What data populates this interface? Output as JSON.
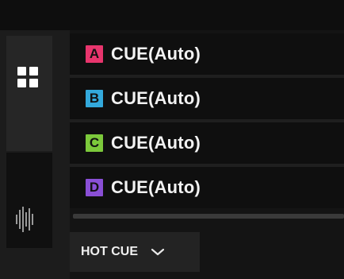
{
  "cues": [
    {
      "letter": "A",
      "label": "CUE(Auto)",
      "color": "#e8356d"
    },
    {
      "letter": "B",
      "label": "CUE(Auto)",
      "color": "#33a9dc"
    },
    {
      "letter": "C",
      "label": "CUE(Auto)",
      "color": "#7cc93b"
    },
    {
      "letter": "D",
      "label": "CUE(Auto)",
      "color": "#8a4fd6"
    }
  ],
  "dropdown": {
    "label": "HOT CUE",
    "icon": "chevron-down-icon"
  },
  "rail": {
    "top_icon": "grid-icon",
    "bottom_icon": "waveform-icon"
  }
}
